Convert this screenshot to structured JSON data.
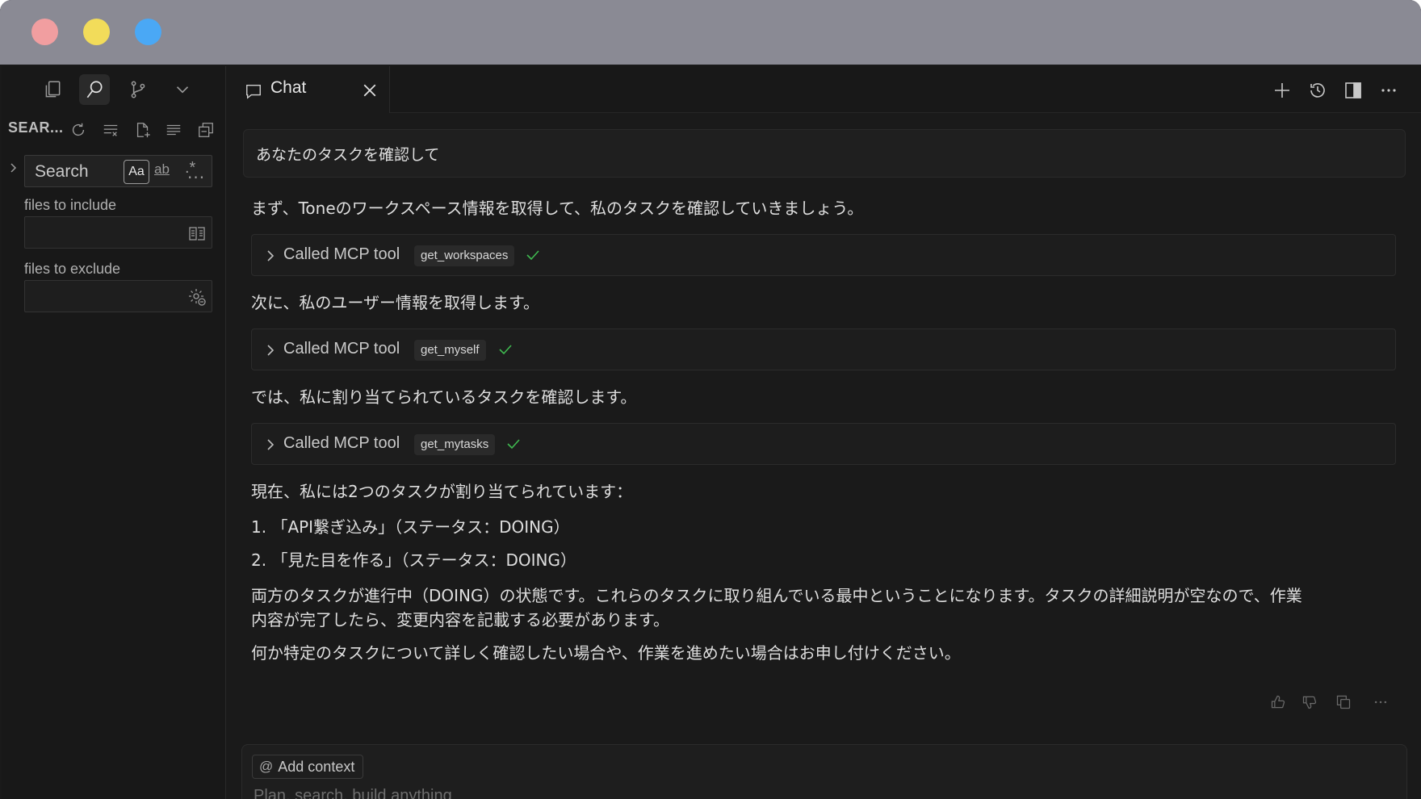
{
  "sidebar": {
    "title": "SEAR...",
    "search": {
      "label": "Search",
      "match_case": "Aa",
      "whole_word": "ab",
      "regex": ".*"
    },
    "more": "···",
    "include_label": "files to include",
    "exclude_label": "files to exclude"
  },
  "tab": {
    "label": "Chat"
  },
  "chat": {
    "user_message": "あなたのタスクを確認して",
    "p1": "まず、Toneのワークスペース情報を取得して、私のタスクを確認していきましょう。",
    "tool_label": "Called MCP tool",
    "tool1": "get_workspaces",
    "p2": "次に、私のユーザー情報を取得します。",
    "tool2": "get_myself",
    "p3": "では、私に割り当てられているタスクを確認します。",
    "tool3": "get_mytasks",
    "p4": "現在、私には2つのタスクが割り当てられています：",
    "item1": "1. 「API繋ぎ込み」（ステータス：DOING）",
    "item2": "2. 「見た目を作る」（ステータス：DOING）",
    "p5_line1": "両方のタスクが進行中（DOING）の状態です。これらのタスクに取り組んでいる最中ということになります。タスクの詳細説明が空なので、作業",
    "p5_line2": "内容が完了したら、変更内容を記載する必要があります。",
    "p6": "何か特定のタスクについて詳しく確認したい場合や、作業を進めたい場合はお申し付けください。"
  },
  "composer": {
    "add_context": "Add context",
    "placeholder": "Plan, search, build anything"
  },
  "colors": {
    "check": "#3fb950",
    "traffic_red": "#f19ea0",
    "traffic_yellow": "#f2dc5a",
    "traffic_blue": "#4aa8f5"
  },
  "icons": [
    "files-icon",
    "search-icon",
    "source-control-icon",
    "chevron-down-icon",
    "refresh-icon",
    "clear-results-icon",
    "new-search-editor-icon",
    "view-as-tree-icon",
    "collapse-all-icon",
    "book-icon",
    "exclude-settings-icon",
    "chat-icon",
    "close-icon",
    "plus-icon",
    "history-icon",
    "split-panel-icon",
    "more-icon",
    "chevron-right-icon",
    "check-icon",
    "thumbs-up-icon",
    "thumbs-down-icon",
    "copy-icon",
    "at-icon"
  ]
}
